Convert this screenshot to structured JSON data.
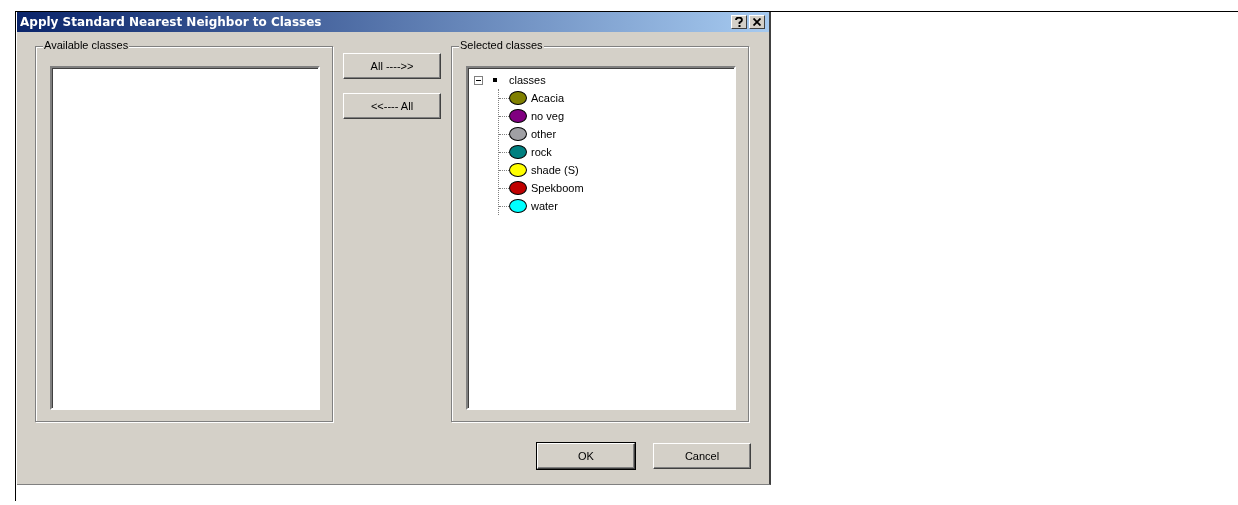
{
  "window": {
    "title": "Apply Standard Nearest Neighbor to Classes"
  },
  "available": {
    "label": "Available classes"
  },
  "move_buttons": [
    "All ---->>",
    "<<---- All"
  ],
  "selected": {
    "label": "Selected classes",
    "tree": [
      {
        "label": "classes",
        "expanded": true,
        "children": [
          {
            "label": "Acacia",
            "color": "#808000"
          },
          {
            "label": "no veg",
            "color": "#800080"
          },
          {
            "label": "other",
            "color": "#a0a0a4"
          },
          {
            "label": "rock",
            "color": "#008080"
          },
          {
            "label": "shade (S)",
            "color": "#ffff00"
          },
          {
            "label": "Spekboom",
            "color": "#c00000"
          },
          {
            "label": "water",
            "color": "#00ffff"
          }
        ]
      }
    ]
  },
  "buttons": [
    {
      "label": "OK",
      "default": true
    },
    {
      "label": "Cancel",
      "default": false
    }
  ]
}
